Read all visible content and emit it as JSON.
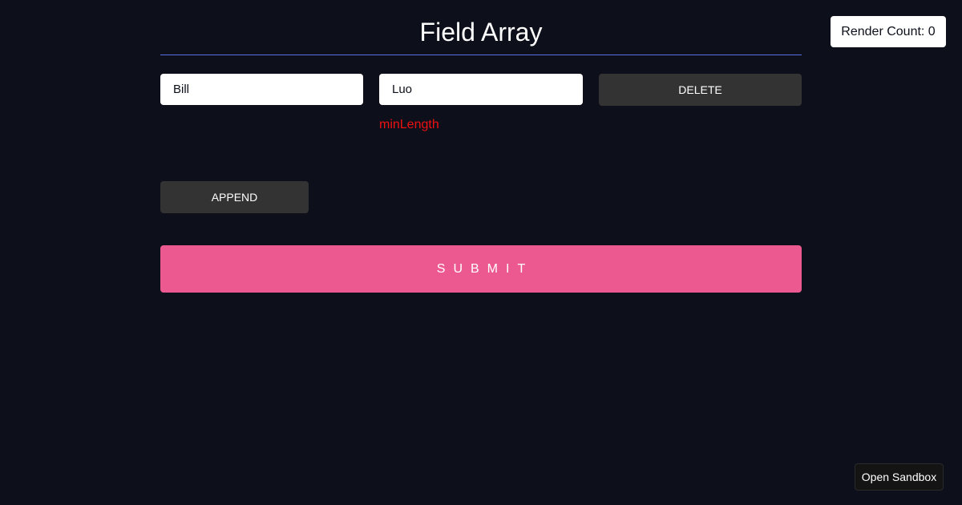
{
  "render_count": "Render Count: 0",
  "form": {
    "title": "Field Array",
    "rows": [
      {
        "first_name": "Bill",
        "last_name": "Luo",
        "delete_label": "DELETE",
        "error": "minLength"
      }
    ],
    "append_label": "APPEND",
    "submit_label": "SUBMIT"
  },
  "sandbox_label": "Open Sandbox",
  "colors": {
    "background": "#0d0f1a",
    "accent_submit": "#ec5990",
    "divider": "#5b6ee1",
    "error": "#ee1111",
    "button_dark": "#333333"
  }
}
